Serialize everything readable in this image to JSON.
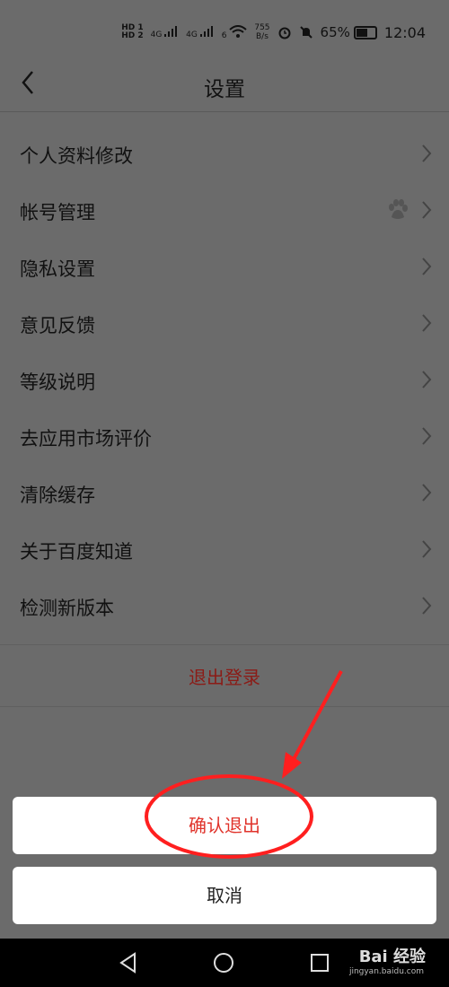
{
  "status_bar": {
    "hd1": "HD 1",
    "hd2": "HD 2",
    "sig1": "4G",
    "sig2": "4G",
    "wifi_badge": "6",
    "net_speed_value": "755",
    "net_speed_unit": "B/s",
    "battery": "65%",
    "battery_level": 0.65,
    "time": "12:04"
  },
  "header": {
    "title": "设置"
  },
  "menu": {
    "items": [
      {
        "label": "个人资料修改"
      },
      {
        "label": "帐号管理"
      },
      {
        "label": "隐私设置"
      },
      {
        "label": "意见反馈"
      },
      {
        "label": "等级说明"
      },
      {
        "label": "去应用市场评价"
      },
      {
        "label": "清除缓存"
      },
      {
        "label": "关于百度知道"
      },
      {
        "label": "检测新版本"
      }
    ]
  },
  "logout": {
    "label": "退出登录"
  },
  "sheet": {
    "confirm_label": "确认退出",
    "cancel_label": "取消"
  },
  "watermark": {
    "brand": "Bai 经验",
    "url": "jingyan.baidu.com"
  },
  "colors": {
    "overlay": "#6b6b6b",
    "logout": "#8b1b16",
    "confirm": "#e0332b",
    "annotation": "#ff1f1f"
  }
}
